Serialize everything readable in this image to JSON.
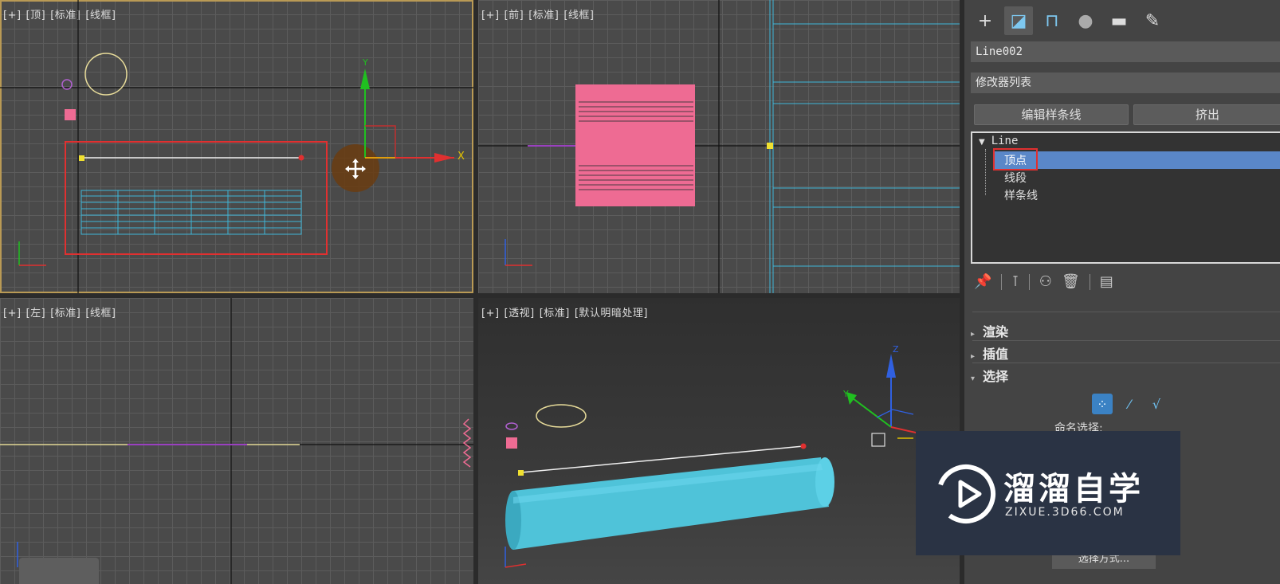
{
  "viewports": {
    "top": {
      "labels": [
        "[+]",
        "[顶]",
        "[标准]",
        "[线框]"
      ]
    },
    "front": {
      "labels": [
        "[+]",
        "[前]",
        "[标准]",
        "[线框]"
      ]
    },
    "left": {
      "labels": [
        "[+]",
        "[左]",
        "[标准]",
        "[线框]"
      ]
    },
    "perspective": {
      "labels": [
        "[+]",
        "[透视]",
        "[标准]",
        "[默认明暗处理]"
      ]
    }
  },
  "axis_labels": {
    "x": "X",
    "y": "Y",
    "z": "Z"
  },
  "command_panel": {
    "tabs": [
      {
        "icon": "plus-icon",
        "glyph": "+"
      },
      {
        "icon": "modify-icon",
        "glyph": "◪"
      },
      {
        "icon": "hierarchy-icon",
        "glyph": "⊓"
      },
      {
        "icon": "motion-icon",
        "glyph": "●"
      },
      {
        "icon": "display-icon",
        "glyph": "▬"
      },
      {
        "icon": "utilities-icon",
        "glyph": "✎"
      }
    ],
    "object_name": "Line002",
    "modifier_list": "修改器列表",
    "buttons": {
      "edit_spline": "编辑样条线",
      "extrude": "挤出"
    },
    "stack": {
      "root": "Line",
      "items": [
        "顶点",
        "线段",
        "样条线"
      ],
      "selected": "顶点"
    },
    "rollouts": [
      {
        "label": "渲染",
        "expanded": false
      },
      {
        "label": "插值",
        "expanded": false
      },
      {
        "label": "选择",
        "expanded": true
      }
    ],
    "named_selection": "命名选择:",
    "selection_mode_button": "选择方式..."
  },
  "watermark": {
    "title": "溜溜自学",
    "subtitle": "ZIXUE.3D66.COM"
  },
  "colors": {
    "selection_blue": "#5a87c8",
    "pink_object": "#ee6b93",
    "cyan_object": "#4fc3d9",
    "highlight_red": "#e03030",
    "active_border": "#b99a55"
  }
}
